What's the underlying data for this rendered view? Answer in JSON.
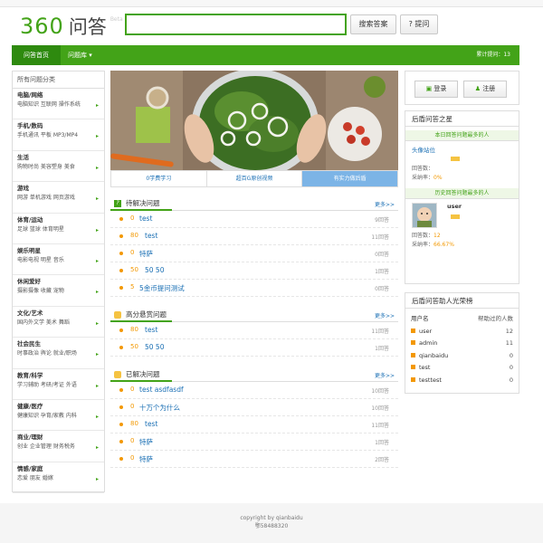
{
  "header": {
    "logo_num": "360",
    "logo_word": "问答",
    "logo_tag": "Beta",
    "search_value": "",
    "search_btn": "搜索答案",
    "ask_btn": "? 提问"
  },
  "nav": {
    "home": "问答首页",
    "library": "问题库 ▾",
    "count": "累计提问：13"
  },
  "sidebar": {
    "title": "所有问题分类",
    "items": [
      {
        "h": "电脑/网络",
        "s": "电脑知识 互联网 操作系统"
      },
      {
        "h": "手机/数码",
        "s": "手机通讯 平板 MP3/MP4"
      },
      {
        "h": "生活",
        "s": "购物时尚 美容塑身 美食"
      },
      {
        "h": "游戏",
        "s": "网游 单机游戏 网页游戏"
      },
      {
        "h": "体育/运动",
        "s": "足球 篮球 体育明星"
      },
      {
        "h": "娱乐明星",
        "s": "电影电视 明星 音乐"
      },
      {
        "h": "休闲爱好",
        "s": "摄影摄像 收藏 宠物"
      },
      {
        "h": "文化/艺术",
        "s": "国内外文学 美术 舞蹈"
      },
      {
        "h": "社会民生",
        "s": "时事政治 舆论 就业/职场"
      },
      {
        "h": "教育/科学",
        "s": "学习辅助 考研/考证 外语"
      },
      {
        "h": "健康/医疗",
        "s": "健康知识 孕育/家教 内科"
      },
      {
        "h": "商业/理财",
        "s": "创业 企业管理 财务税务"
      },
      {
        "h": "情感/家庭",
        "s": "恋爱 朋友 婚嫁"
      }
    ]
  },
  "tabs": [
    "0学费学习",
    "超百G原创视频",
    "有实力做后盾"
  ],
  "sections": [
    {
      "title": "待解决问题",
      "more": "更多>>",
      "rows": [
        {
          "score": "0",
          "q": "test",
          "a": "9回答"
        },
        {
          "score": "80",
          "q": "test",
          "a": "11回答"
        },
        {
          "score": "0",
          "q": "特萨",
          "a": "0回答"
        },
        {
          "score": "50",
          "q": "50 50",
          "a": "1回答"
        },
        {
          "score": "5",
          "q": "5金币提问测试",
          "a": "0回答"
        }
      ]
    },
    {
      "title": "高分悬赏问题",
      "more": "更多>>",
      "rows": [
        {
          "score": "80",
          "q": "test",
          "a": "11回答"
        },
        {
          "score": "50",
          "q": "50 50",
          "a": "1回答"
        }
      ]
    },
    {
      "title": "已解决问题",
      "more": "更多>>",
      "rows": [
        {
          "score": "0",
          "q": "test asdfasdf",
          "a": "10回答"
        },
        {
          "score": "0",
          "q": "十万个为什么",
          "a": "10回答"
        },
        {
          "score": "80",
          "q": "test",
          "a": "11回答"
        },
        {
          "score": "0",
          "q": "特萨",
          "a": "1回答"
        },
        {
          "score": "0",
          "q": "特萨",
          "a": "2回答"
        }
      ]
    }
  ],
  "login": {
    "login": "登录",
    "register": "注册"
  },
  "stars": {
    "title": "后盾问答之星",
    "today": "本日回答问题最多的人",
    "today_name": "头像站位",
    "today_ans_label": "回答数：",
    "today_rate_label": "采纳率：",
    "today_rate": "0%",
    "hist": "历史回答问题最多的人",
    "hist_name": "user",
    "hist_ans_label": "回答数：",
    "hist_ans": "12",
    "hist_rate_label": "采纳率：",
    "hist_rate": "66.67%"
  },
  "honor": {
    "title": "后盾问答助人光荣榜",
    "col_user": "用户名",
    "col_count": "帮助过的人数",
    "rows": [
      {
        "name": "user",
        "count": "12"
      },
      {
        "name": "admin",
        "count": "11"
      },
      {
        "name": "qianbaidu",
        "count": "0"
      },
      {
        "name": "test",
        "count": "0"
      },
      {
        "name": "testtest",
        "count": "0"
      }
    ]
  },
  "footer": {
    "line1": "copyright by qianbaidu",
    "line2": "鄂58488320"
  }
}
